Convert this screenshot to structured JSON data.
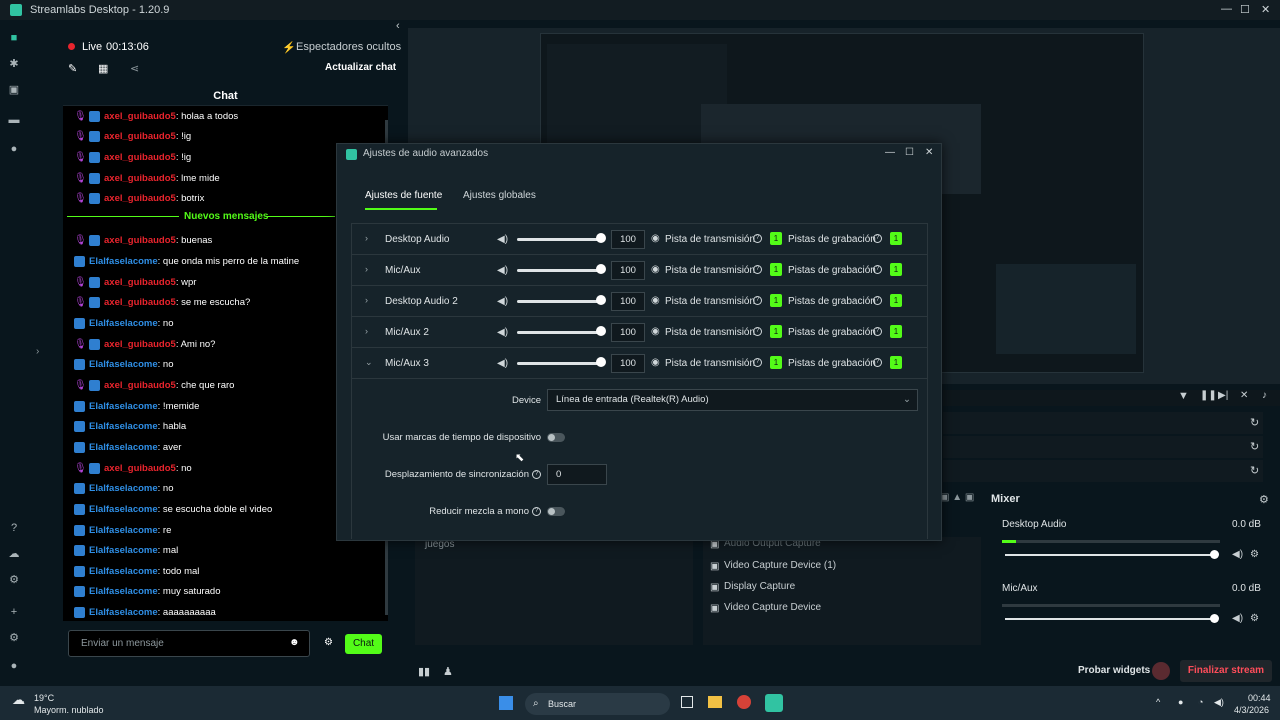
{
  "window": {
    "title": "Streamlabs Desktop - 1.20.9"
  },
  "status": {
    "live_label": "Live",
    "live_time": "00:13:06",
    "viewers_label": "Espectadores ocultos",
    "refresh_chat": "Actualizar chat"
  },
  "chat": {
    "header": "Chat",
    "new_messages": "Nuevos mensajes",
    "messages": [
      {
        "user": "axel_guibaudo5",
        "text": ": holaa a todos",
        "color": "#e8242d",
        "icon": "mic"
      },
      {
        "user": "axel_guibaudo5",
        "text": ": !ig",
        "color": "#e8242d",
        "icon": "mic"
      },
      {
        "user": "axel_guibaudo5",
        "text": ": !ig",
        "color": "#e8242d",
        "icon": "mic"
      },
      {
        "user": "axel_guibaudo5",
        "text": ": lme mide",
        "color": "#e8242d",
        "icon": "mic"
      },
      {
        "user": "axel_guibaudo5",
        "text": ": botrix",
        "color": "#e8242d",
        "icon": "mic"
      },
      {
        "user": "axel_guibaudo5",
        "text": ": buenas",
        "color": "#e8242d",
        "icon": "mic"
      },
      {
        "user": "Elalfaselacome",
        "text": ": que onda mis perro de la matine",
        "color": "#2f8fe6",
        "icon": "kick"
      },
      {
        "user": "axel_guibaudo5",
        "text": ": wpr",
        "color": "#e8242d",
        "icon": "mic"
      },
      {
        "user": "axel_guibaudo5",
        "text": ": se me escucha?",
        "color": "#e8242d",
        "icon": "mic"
      },
      {
        "user": "Elalfaselacome",
        "text": ": no",
        "color": "#2f8fe6",
        "icon": "kick"
      },
      {
        "user": "axel_guibaudo5",
        "text": ": Ami no?",
        "color": "#e8242d",
        "icon": "mic"
      },
      {
        "user": "Elalfaselacome",
        "text": ": no",
        "color": "#2f8fe6",
        "icon": "kick"
      },
      {
        "user": "axel_guibaudo5",
        "text": ": che que raro",
        "color": "#e8242d",
        "icon": "mic"
      },
      {
        "user": "Elalfaselacome",
        "text": ": !memide",
        "color": "#2f8fe6",
        "icon": "kick"
      },
      {
        "user": "Elalfaselacome",
        "text": ": habla",
        "color": "#2f8fe6",
        "icon": "kick"
      },
      {
        "user": "Elalfaselacome",
        "text": ": aver",
        "color": "#2f8fe6",
        "icon": "kick"
      },
      {
        "user": "axel_guibaudo5",
        "text": ": no",
        "color": "#e8242d",
        "icon": "mic"
      },
      {
        "user": "Elalfaselacome",
        "text": ": no",
        "color": "#2f8fe6",
        "icon": "kick"
      },
      {
        "user": "Elalfaselacome",
        "text": ": se escucha doble el video",
        "color": "#2f8fe6",
        "icon": "kick"
      },
      {
        "user": "Elalfaselacome",
        "text": ": re",
        "color": "#2f8fe6",
        "icon": "kick"
      },
      {
        "user": "Elalfaselacome",
        "text": ": mal",
        "color": "#2f8fe6",
        "icon": "kick"
      },
      {
        "user": "Elalfaselacome",
        "text": ": todo mal",
        "color": "#2f8fe6",
        "icon": "kick"
      },
      {
        "user": "Elalfaselacome",
        "text": ": muy saturado",
        "color": "#2f8fe6",
        "icon": "kick"
      },
      {
        "user": "Elalfaselacome",
        "text": ": aaaaaaaaaa",
        "color": "#2f8fe6",
        "icon": "kick"
      }
    ],
    "input_placeholder": "Enviar un mensaje",
    "send_button": "Chat"
  },
  "dialog": {
    "title": "Ajustes de audio avanzados",
    "tabs": [
      "Ajustes de fuente",
      "Ajustes globales"
    ],
    "sources": [
      {
        "name": "Desktop Audio",
        "volume": "100",
        "track_label": "Pista de transmisión",
        "track_value": "1",
        "rec_label": "Pistas de grabación",
        "rec_value": "1"
      },
      {
        "name": "Mic/Aux",
        "volume": "100",
        "track_label": "Pista de transmisión",
        "track_value": "1",
        "rec_label": "Pistas de grabación",
        "rec_value": "1"
      },
      {
        "name": "Desktop Audio 2",
        "volume": "100",
        "track_label": "Pista de transmisión",
        "track_value": "1",
        "rec_label": "Pistas de grabación",
        "rec_value": "1"
      },
      {
        "name": "Mic/Aux 2",
        "volume": "100",
        "track_label": "Pista de transmisión",
        "track_value": "1",
        "rec_label": "Pistas de grabación",
        "rec_value": "1"
      },
      {
        "name": "Mic/Aux 3",
        "volume": "100",
        "track_label": "Pista de transmisión",
        "track_value": "1",
        "rec_label": "Pistas de grabación",
        "rec_value": "1"
      }
    ],
    "device_label": "Device",
    "device_value": "Línea de entrada (Realtek(R) Audio)",
    "timestamps_label": "Usar marcas de tiempo de dispositivo",
    "sync_label": "Desplazamiento de sincronización",
    "sync_value": "0",
    "mono_label": "Reducir mezcla a mono"
  },
  "mixer": {
    "title": "Mixer",
    "items": [
      {
        "name": "Desktop Audio",
        "db": "0.0 dB"
      },
      {
        "name": "Mic/Aux",
        "db": "0.0 dB"
      }
    ]
  },
  "scenes": {
    "partial": "juegos"
  },
  "sources_list": [
    "Audio Output Capture",
    "Video Capture Device (1)",
    "Display Capture",
    "Video Capture Device"
  ],
  "footer": {
    "test_widgets": "Probar widgets",
    "end_stream": "Finalizar stream"
  },
  "taskbar": {
    "temp": "19°C",
    "weather": "Mayorm. nublado",
    "search": "Buscar",
    "time": "00:44",
    "date": "4/3/2026"
  }
}
